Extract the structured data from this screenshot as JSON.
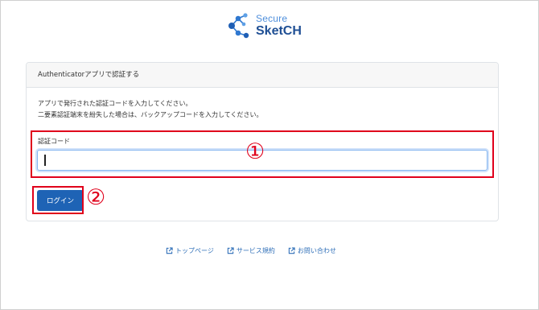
{
  "logo": {
    "line1": "Secure",
    "line2": "SketCH",
    "icon": "molecule-network-icon"
  },
  "card": {
    "header": "Authenticatorアプリで認証する",
    "info_line1": "アプリで発行された認証コードを入力してください。",
    "info_line2": "二要素認証端末を紛失した場合は、バックアップコードを入力してください。",
    "code_label": "認証コード",
    "code_value": "",
    "login_button": "ログイン"
  },
  "annotations": {
    "marker1": "①",
    "marker2": "②",
    "color": "#e0001b"
  },
  "footer": {
    "links": [
      {
        "label": "トップページ",
        "icon": "external-link-icon"
      },
      {
        "label": "サービス規約",
        "icon": "external-link-icon"
      },
      {
        "label": "お問い合わせ",
        "icon": "external-link-icon"
      }
    ]
  },
  "colors": {
    "brand_dark": "#1f4f94",
    "brand_light": "#4f8fdc",
    "button": "#1e63b5",
    "link": "#2f6fb8"
  }
}
